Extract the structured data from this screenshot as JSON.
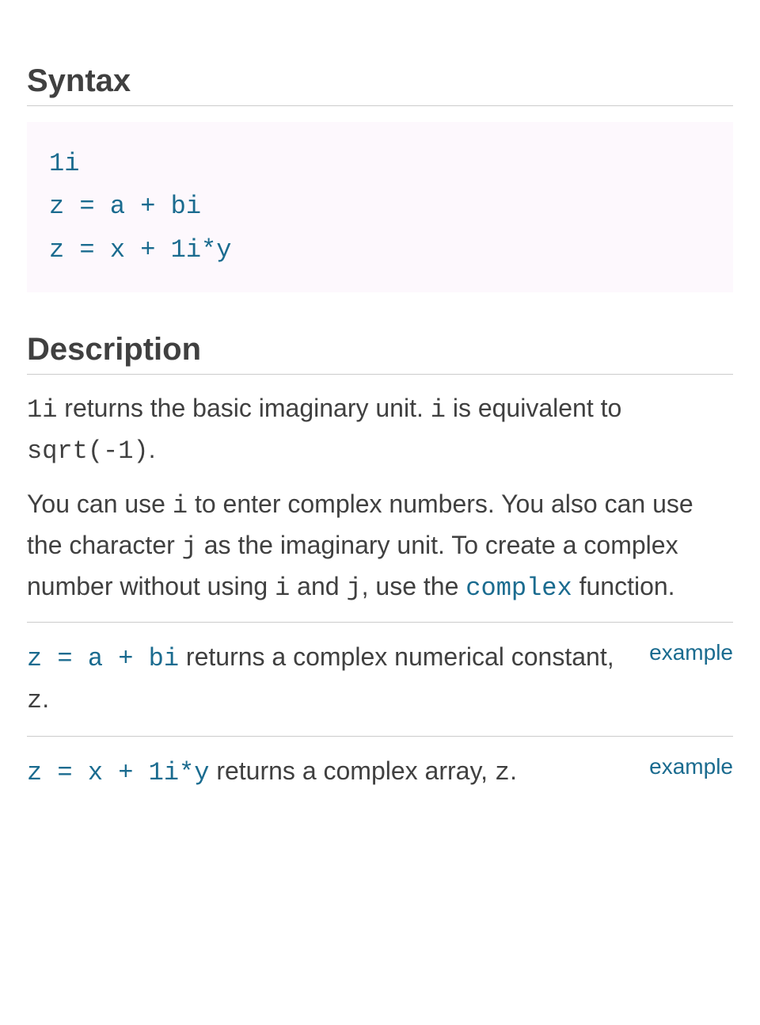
{
  "sections": {
    "syntax": {
      "heading": "Syntax",
      "lines": [
        "1i",
        "z = a + bi",
        "z = x + 1i*y"
      ]
    },
    "description": {
      "heading": "Description",
      "para1": {
        "c1": "1i",
        "t1": " returns the basic imaginary unit. ",
        "c2": "i",
        "t2": " is equivalent to ",
        "c3": "sqrt(-1)",
        "t3": "."
      },
      "para2": {
        "t1": "You can use ",
        "c1": "i",
        "t2": " to enter complex numbers. You also can use the character ",
        "c2": "j",
        "t3": " as the imaginary unit. To create a complex number without using ",
        "c3": "i",
        "t4": " and ",
        "c4": "j",
        "t5": ", use the ",
        "link": "complex",
        "t6": " function."
      },
      "items": [
        {
          "syntax": "z = a + bi",
          "text_after": " returns a complex numerical constant, ",
          "var": "z",
          "tail": ".",
          "example": "example"
        },
        {
          "syntax": "z = x + 1i*y",
          "text_after": " returns a complex array, ",
          "var": "z",
          "tail": ".",
          "example": "example"
        }
      ]
    }
  }
}
